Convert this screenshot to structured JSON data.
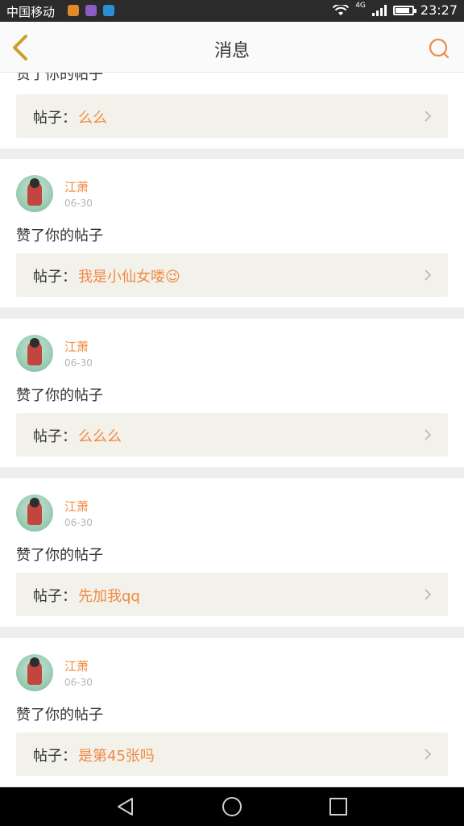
{
  "status_bar": {
    "carrier": "中国移动",
    "network": "4G",
    "time": "23:27"
  },
  "header": {
    "title": "消息"
  },
  "partial_item": {
    "action": "赞了你的帖子",
    "post_label": "帖子：",
    "post_title": "么么"
  },
  "items": [
    {
      "name": "江萧",
      "date": "06-30",
      "action": "赞了你的帖子",
      "post_label": "帖子：",
      "post_title": "我是小仙女喽😉"
    },
    {
      "name": "江萧",
      "date": "06-30",
      "action": "赞了你的帖子",
      "post_label": "帖子：",
      "post_title": "么么么"
    },
    {
      "name": "江萧",
      "date": "06-30",
      "action": "赞了你的帖子",
      "post_label": "帖子：",
      "post_title": "先加我qq"
    },
    {
      "name": "江萧",
      "date": "06-30",
      "action": "赞了你的帖子",
      "post_label": "帖子：",
      "post_title": "是第45张吗"
    }
  ],
  "colors": {
    "accent": "#f08a43",
    "back_arrow": "#c9a12a",
    "post_bg": "#f2f1ea"
  },
  "icons": [
    "back-icon",
    "search-icon",
    "chevron-right-icon",
    "nav-back-icon",
    "nav-home-icon",
    "nav-recents-icon"
  ]
}
